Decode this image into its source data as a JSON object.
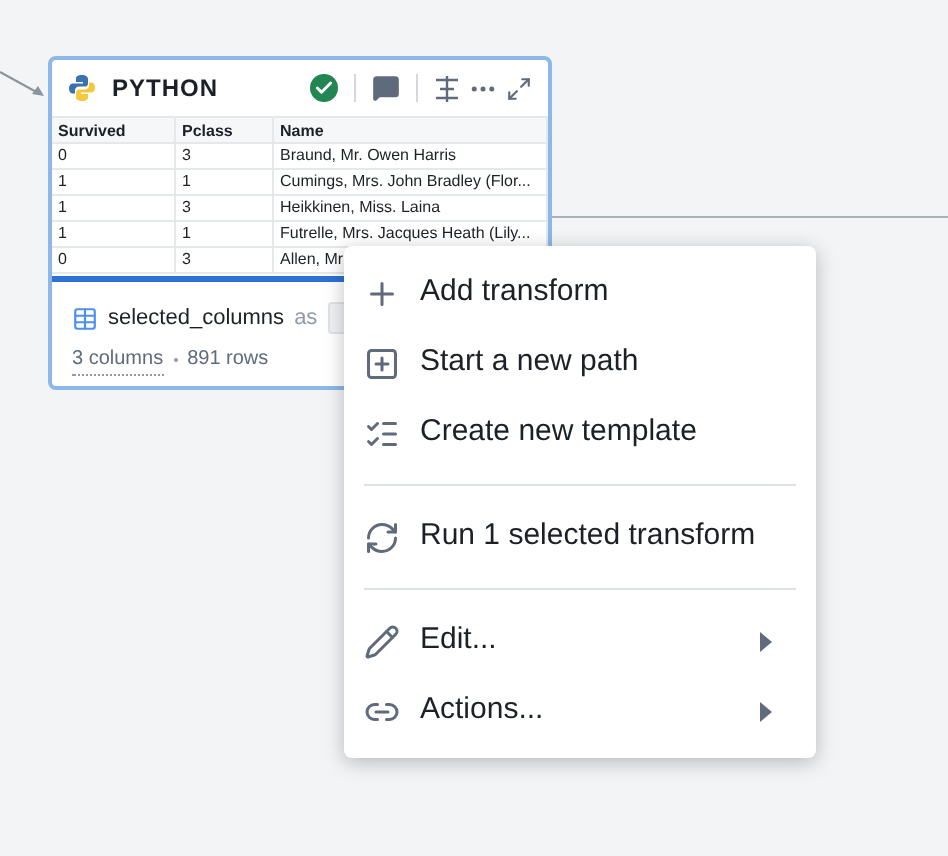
{
  "node": {
    "title": "PYTHON",
    "succeeded": true,
    "table": {
      "columns": [
        "Survived",
        "Pclass",
        "Name"
      ],
      "rows": [
        [
          "0",
          "3",
          "Braund, Mr. Owen Harris"
        ],
        [
          "1",
          "1",
          "Cumings, Mrs. John Bradley (Flor..."
        ],
        [
          "1",
          "3",
          "Heikkinen, Miss. Laina"
        ],
        [
          "1",
          "1",
          "Futrelle, Mrs. Jacques Heath (Lily..."
        ],
        [
          "0",
          "3",
          "Allen, Mr"
        ]
      ]
    },
    "output": {
      "name": "selected_columns",
      "as_label": "as",
      "columns": "3 columns",
      "rows": "891 rows"
    }
  },
  "context_menu": [
    {
      "kind": "item",
      "label": "Add transform",
      "submenu": false
    },
    {
      "kind": "item",
      "label": "Start a new path",
      "submenu": false
    },
    {
      "kind": "item",
      "label": "Create new template",
      "submenu": false
    },
    {
      "kind": "divider"
    },
    {
      "kind": "item",
      "label": "Run 1 selected transform",
      "submenu": false
    },
    {
      "kind": "divider"
    },
    {
      "kind": "item",
      "label": "Edit...",
      "submenu": true
    },
    {
      "kind": "item",
      "label": "Actions...",
      "submenu": true
    }
  ]
}
